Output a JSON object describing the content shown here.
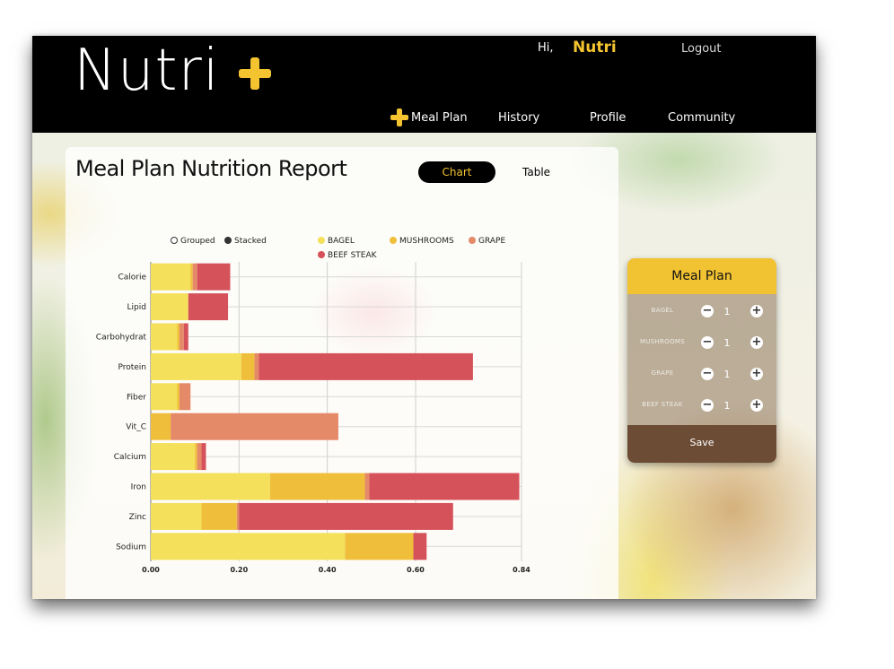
{
  "header": {
    "logo_text": "Nutri",
    "greeting": "Hi,",
    "user_name": "Nutri",
    "logout_label": "Logout",
    "nav": [
      "Meal Plan",
      "History",
      "Profile",
      "Community"
    ]
  },
  "report": {
    "title": "Meal Plan Nutrition Report",
    "tabs": {
      "chart": "Chart",
      "table": "Table",
      "active": "Chart"
    },
    "mode_options": [
      "Grouped",
      "Stacked"
    ],
    "mode_selected": "Stacked"
  },
  "chart_data": {
    "type": "bar",
    "orientation": "horizontal",
    "stacked": true,
    "categories": [
      "Calorie",
      "Lipid",
      "Carbohydrat",
      "Protein",
      "Fiber",
      "Vit_C",
      "Calcium",
      "Iron",
      "Zinc",
      "Sodium"
    ],
    "series": [
      {
        "name": "BAGEL",
        "color": "#f4e05a",
        "values": [
          0.09,
          0.085,
          0.06,
          0.205,
          0.06,
          0.0,
          0.1,
          0.27,
          0.115,
          0.44
        ]
      },
      {
        "name": "MUSHROOMS",
        "color": "#efbf3c",
        "values": [
          0.005,
          0.0,
          0.005,
          0.03,
          0.005,
          0.045,
          0.005,
          0.215,
          0.08,
          0.155
        ]
      },
      {
        "name": "GRAPE",
        "color": "#e58a68",
        "values": [
          0.01,
          0.0,
          0.01,
          0.01,
          0.025,
          0.38,
          0.01,
          0.01,
          0.005,
          0.0
        ]
      },
      {
        "name": "BEEF STEAK",
        "color": "#d6525a",
        "values": [
          0.075,
          0.09,
          0.01,
          0.485,
          0.0,
          0.0,
          0.01,
          0.34,
          0.485,
          0.03
        ]
      }
    ],
    "x_ticks": [
      "0.00",
      "0.20",
      "0.40",
      "0.60",
      "0.84"
    ],
    "xlim": [
      0,
      0.84
    ],
    "grid": true,
    "legend_position": "top"
  },
  "meal_plan": {
    "title": "Meal Plan",
    "items": [
      {
        "name": "BAGEL",
        "qty": "1"
      },
      {
        "name": "MUSHROOMS",
        "qty": "1"
      },
      {
        "name": "GRAPE",
        "qty": "1"
      },
      {
        "name": "BEEF STEAK",
        "qty": "1"
      }
    ],
    "minus_symbol": "−",
    "plus_symbol": "+",
    "save_label": "Save"
  },
  "colors": {
    "header_bg": "#000000",
    "accent": "#f4c430",
    "meal_plan_header": "#f1c232",
    "save_bg": "#6d4c35"
  },
  "icons": [
    "plus-logo-icon",
    "plus-nav-icon",
    "minus-icon",
    "plus-icon"
  ]
}
